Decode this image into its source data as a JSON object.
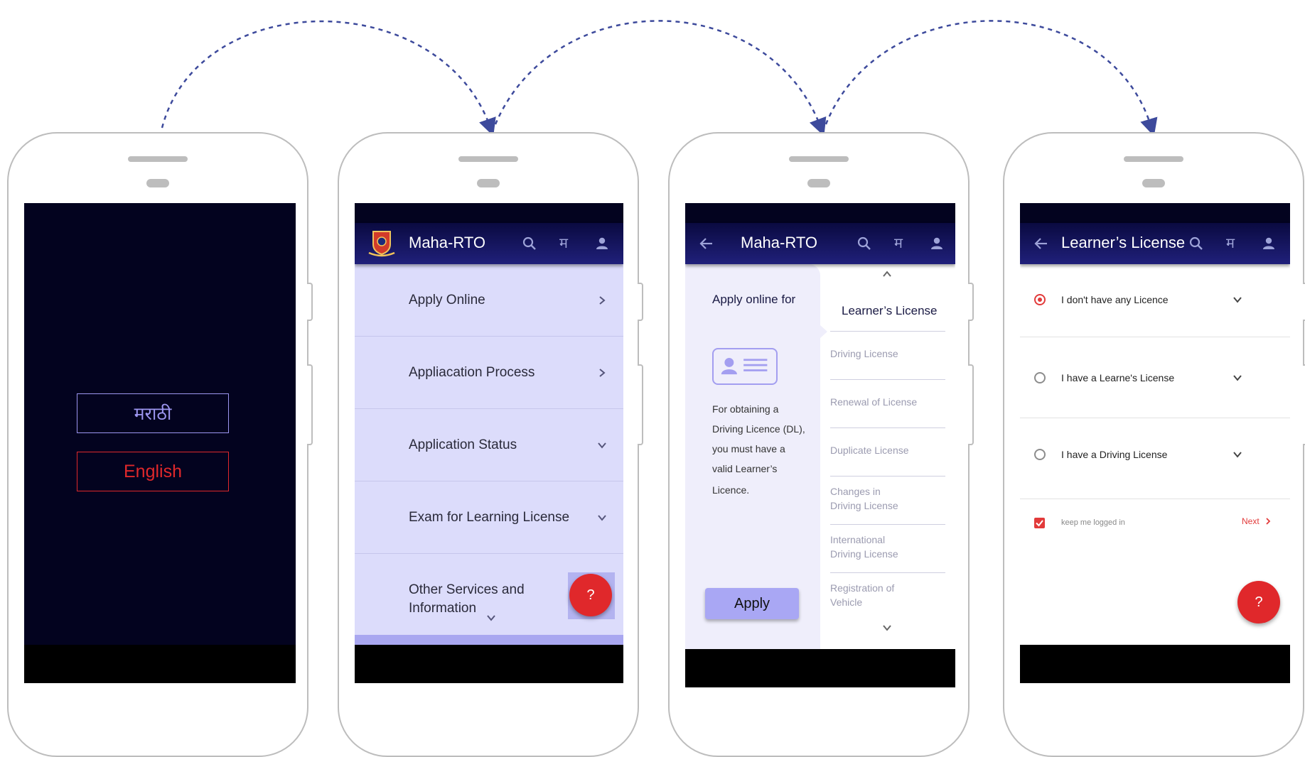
{
  "screen1": {
    "lang_marathi": "मराठी",
    "lang_english": "English"
  },
  "screen2": {
    "title": "Maha-RTO",
    "lang_icon_text": "म",
    "menu": [
      {
        "label": "Apply Online"
      },
      {
        "label": "Appliacation Process"
      },
      {
        "label": "Application Status"
      },
      {
        "label": "Exam for Learning License"
      },
      {
        "label_line1": "Other Services and",
        "label_line2": "Information"
      }
    ],
    "help_label": "?"
  },
  "screen3": {
    "title": "Maha-RTO",
    "lang_icon_text": "म",
    "apply_online_for": "Apply online for",
    "description_lines": [
      "For obtaining a",
      "Driving Licence (DL),",
      "you must have a",
      "valid Learner’s",
      "Licence."
    ],
    "apply_button": "Apply",
    "selected_item": "Learner’s License",
    "items": [
      {
        "line1": "Driving License",
        "line2": ""
      },
      {
        "line1": "Renewal of License",
        "line2": ""
      },
      {
        "line1": "Duplicate License",
        "line2": ""
      },
      {
        "line1": "Changes in",
        "line2": "Driving License"
      },
      {
        "line1": "International",
        "line2": "Driving License"
      },
      {
        "line1": "Registration of",
        "line2": "Vehicle"
      }
    ]
  },
  "screen4": {
    "title": "Learner’s License",
    "lang_icon_text": "म",
    "options": [
      {
        "label": "I don't have any Licence",
        "selected": true
      },
      {
        "label": "I have a Learne's License",
        "selected": false
      },
      {
        "label": "I have a Driving License",
        "selected": false
      }
    ],
    "keep_logged_in": "keep me logged in",
    "next_label": "Next",
    "help_label": "?"
  },
  "colors": {
    "app_bar": "#14145c",
    "dark_bg": "#03031f",
    "accent_red": "#e0282b",
    "menu_bg": "#dcdcfb",
    "flow_arrow": "#3d4a9c"
  }
}
